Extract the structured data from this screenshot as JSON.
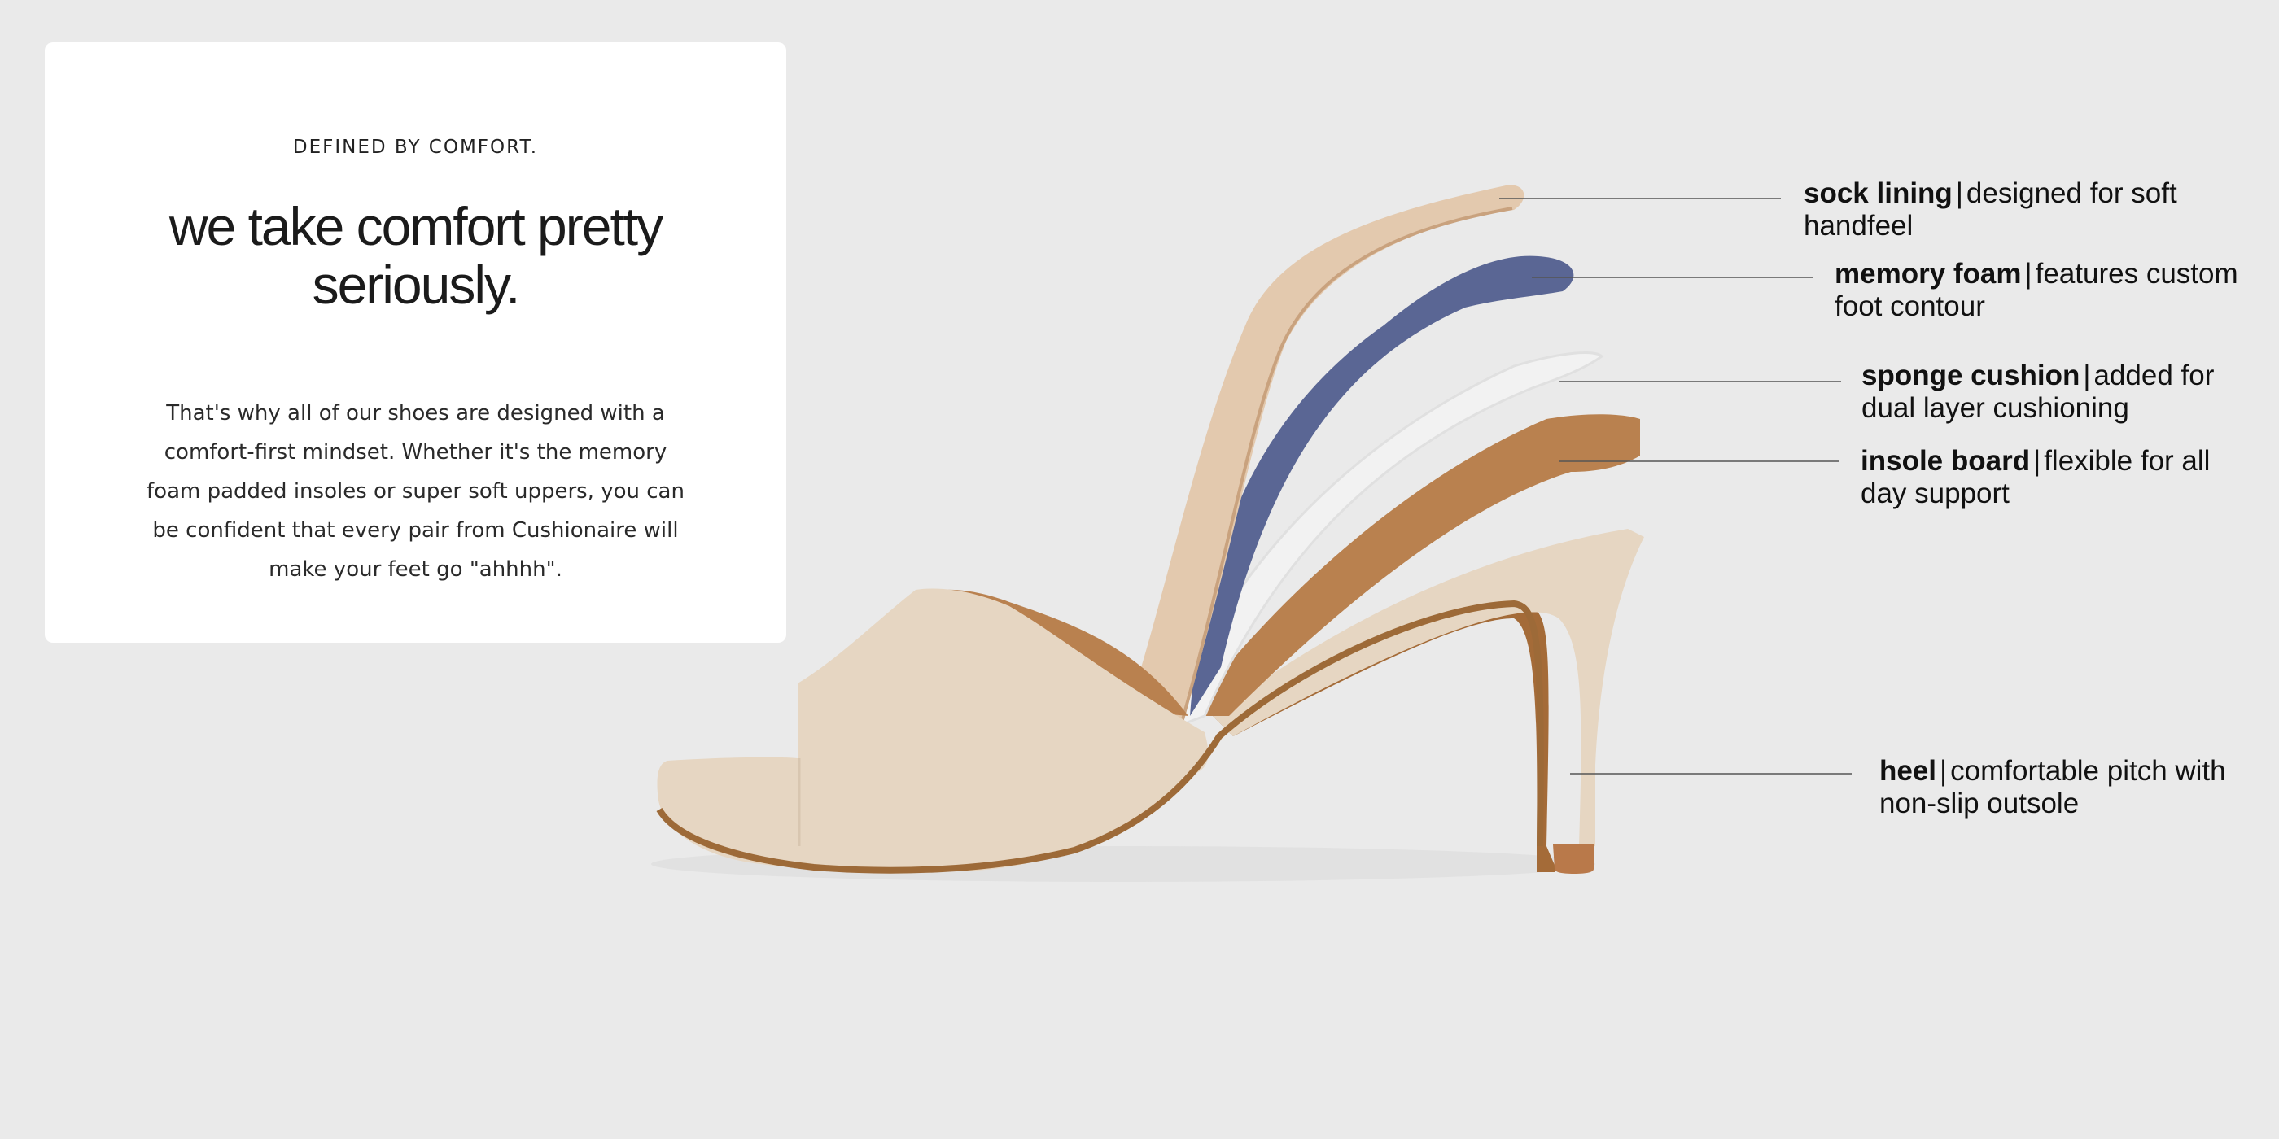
{
  "intro_card": {
    "eyebrow": "DEFINED BY COMFORT.",
    "headline": "we take comfort pretty seriously.",
    "body": "That's why all of our shoes are designed with a comfort-first mindset. Whether it's the memory foam padded insoles or super soft uppers, you can be confident that every pair from Cushionaire will make your feet go \"ahhhh\"."
  },
  "shoe_layers": [
    {
      "name": "sock lining",
      "separator": "|",
      "description": "designed for soft handfeel",
      "color": "#e3c9ae"
    },
    {
      "name": "memory foam",
      "separator": "|",
      "description": "features custom foot contour",
      "color": "#5a6694"
    },
    {
      "name": "sponge cushion",
      "separator": "|",
      "description": "added for dual layer cushioning",
      "color": "#f2f2f2"
    },
    {
      "name": "insole board",
      "separator": "|",
      "description": "flexible for all day support",
      "color": "#b9814f"
    },
    {
      "name": "heel",
      "separator": "|",
      "description": "comfortable pitch with non-slip outsole",
      "color": "#a46b38"
    }
  ],
  "shoe_colors": {
    "upper": "#e6d6c2",
    "sole_edge": "#9d6a38",
    "heel_tip": "#b9794a"
  }
}
